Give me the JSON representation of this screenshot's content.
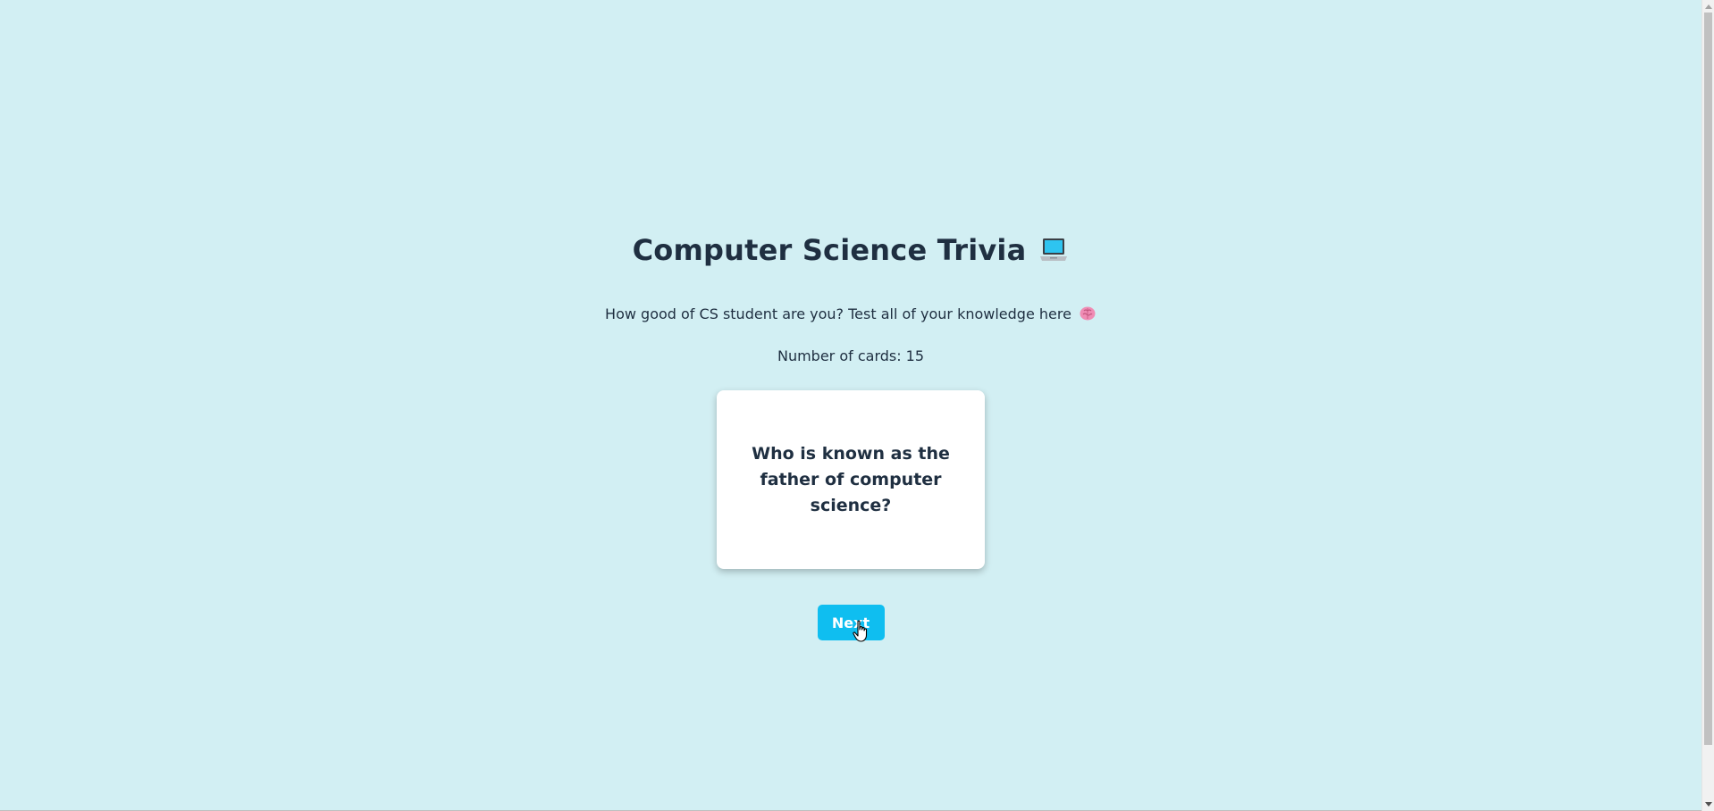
{
  "header": {
    "title": "Computer Science Trivia",
    "title_icon": "laptop-icon"
  },
  "intro": {
    "subtitle": "How good of CS student are you? Test all of your knowledge here",
    "subtitle_icon": "brain-icon",
    "count_label": "Number of cards:",
    "count_value": "15"
  },
  "card": {
    "question": "Who is known as the father of computer science?"
  },
  "controls": {
    "next_label": "Next"
  },
  "colors": {
    "background": "#d2eff3",
    "accent": "#0fbef0",
    "text": "#1f2f41",
    "card": "#ffffff"
  }
}
